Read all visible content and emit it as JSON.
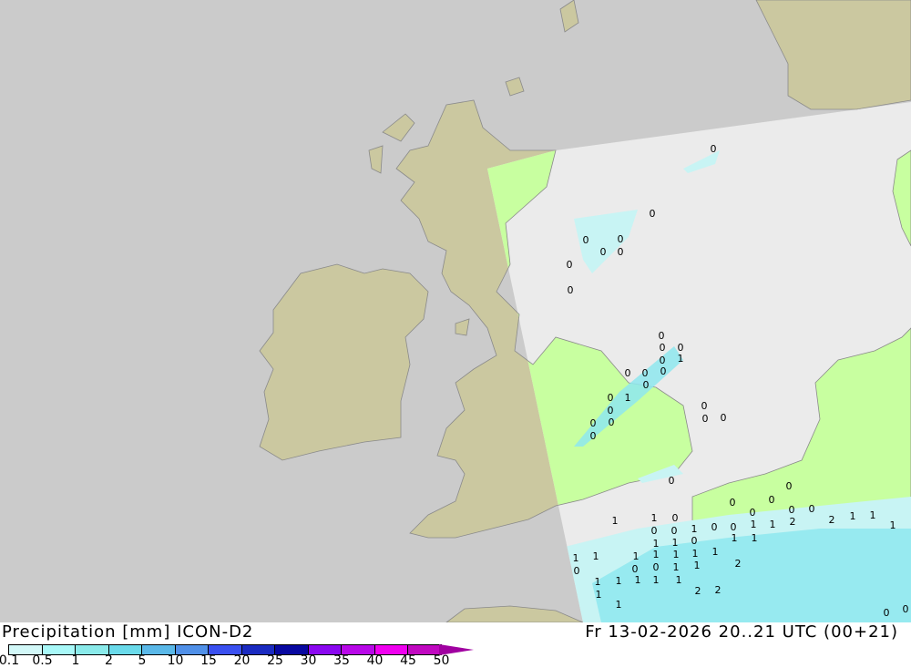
{
  "legend": {
    "title": "Precipitation [mm] ICON-D2",
    "timestamp": "Fr 13-02-2026 20..21 UTC (00+21)",
    "ticks": [
      "0.1",
      "0.5",
      "1",
      "2",
      "5",
      "10",
      "15",
      "20",
      "25",
      "30",
      "35",
      "40",
      "45",
      "50"
    ],
    "colors": [
      "#d2f8f8",
      "#a8f8f8",
      "#8aeaea",
      "#6adaea",
      "#5ab8e8",
      "#5090e8",
      "#3a50f0",
      "#1a2ac0",
      "#0808a0",
      "#8a08f0",
      "#b808e8",
      "#f000f0",
      "#c008c0"
    ],
    "arrow_color": "#a000a0"
  },
  "map": {
    "colors": {
      "outside": "#cbcbcb",
      "outside_land": "#cbc8a0",
      "domain_sea": "#ebebeb",
      "domain_land": "#c8ffa0",
      "coast": "#8a8a8a",
      "precip_light": "#c8f4f4",
      "precip": "#8ee8ee"
    },
    "precip_labels": [
      "0",
      "0",
      "0",
      "0",
      "0",
      "0",
      "0",
      "0",
      "0",
      "0",
      "0",
      "0",
      "1",
      "0",
      "0",
      "0",
      "1",
      "0",
      "0",
      "0",
      "0",
      "0",
      "0",
      "0",
      "0",
      "0",
      "0",
      "0",
      "0",
      "0",
      "0",
      "0",
      "0",
      "1",
      "1",
      "0",
      "1",
      "0",
      "0",
      "1",
      "0",
      "0",
      "1",
      "1",
      "2",
      "2",
      "1",
      "1",
      "1",
      "1",
      "0",
      "1",
      "1",
      "1",
      "2",
      "1",
      "1",
      "1",
      "1",
      "1",
      "1",
      "0",
      "0",
      "0",
      "1",
      "1",
      "1",
      "2",
      "2",
      "1",
      "1",
      "1",
      "1",
      "1",
      "1",
      "0",
      "0"
    ]
  }
}
